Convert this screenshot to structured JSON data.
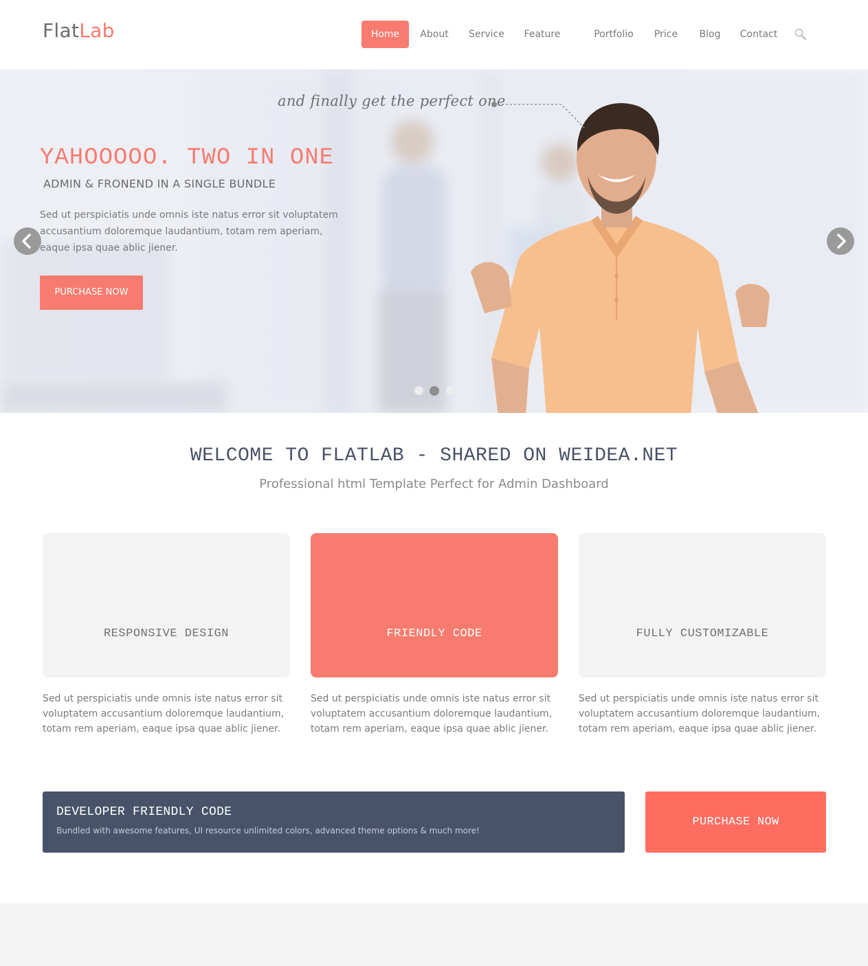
{
  "header": {
    "logo_part1": "Flat",
    "logo_part2": "Lab",
    "nav": [
      "Home",
      "About",
      "Service",
      "Feature",
      "Portfolio",
      "Price",
      "Blog",
      "Contact"
    ],
    "active_nav": "Home",
    "search_icon": "search-icon"
  },
  "hero": {
    "tagline": "and finally get the perfect one",
    "title": "YAHOOOOO. TWO IN ONE",
    "subtitle": "ADMIN & FRONEND IN A SINGLE BUNDLE",
    "text": "Sed ut perspiciatis unde omnis iste natus error sit voluptatem accusantium doloremque laudantium, totam rem aperiam, eaque ipsa quae ablic jiener.",
    "button": "PURCHASE NOW",
    "active_slide": 2,
    "slide_count": 3
  },
  "welcome": {
    "title": "WELCOME TO FLATLAB - SHARED ON WEIDEA.NET",
    "subtitle": "Professional html Template Perfect for Admin Dashboard"
  },
  "features": [
    {
      "title": "RESPONSIVE DESIGN",
      "text": "Sed ut perspiciatis unde omnis iste natus error sit voluptatem accusantium doloremque laudantium, totam rem aperiam, eaque ipsa quae ablic jiener."
    },
    {
      "title": "FRIENDLY CODE",
      "text": "Sed ut perspiciatis unde omnis iste natus error sit voluptatem accusantium doloremque laudantium, totam rem aperiam, eaque ipsa quae ablic jiener."
    },
    {
      "title": "FULLY CUSTOMIZABLE",
      "text": "Sed ut perspiciatis unde omnis iste natus error sit voluptatem accusantium doloremque laudantium, totam rem aperiam, eaque ipsa quae ablic jiener."
    }
  ],
  "cta": {
    "title": "DEVELOPER FRIENDLY CODE",
    "text": "Bundled with awesome features, UI resource unlimited colors, advanced theme options & much more!",
    "button": "PURCHASE NOW"
  },
  "colors": {
    "accent": "#f77b6f",
    "cta_bg": "#48536a",
    "cta_button": "#ff6c60"
  }
}
